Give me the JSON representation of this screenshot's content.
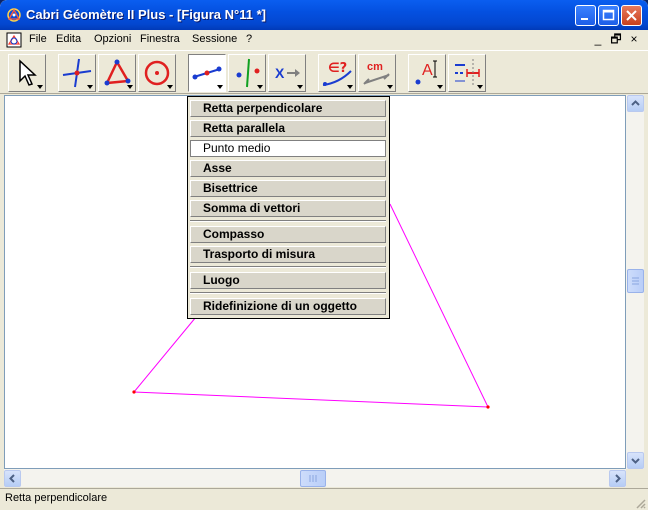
{
  "window": {
    "title": "Cabri Géomètre II Plus - [Figura N°11 *]",
    "buttons": [
      "minimize",
      "maximize",
      "close"
    ]
  },
  "menubar": {
    "items": [
      {
        "label": "File"
      },
      {
        "label": "Edita"
      },
      {
        "label": "Opzioni"
      },
      {
        "label": "Finestra"
      },
      {
        "label": "Sessione"
      },
      {
        "label": "?"
      }
    ],
    "doc_controls": [
      "_",
      "🗗",
      "×"
    ]
  },
  "toolbar": {
    "tools": [
      {
        "name": "pointer",
        "icon": "pointer-arrow-icon"
      },
      {
        "name": "points",
        "icon": "point-on-lines-icon"
      },
      {
        "name": "lines",
        "icon": "triangle-icon"
      },
      {
        "name": "curves",
        "icon": "circle-icon"
      },
      {
        "name": "constructions",
        "icon": "segment-points-icon",
        "active": true
      },
      {
        "name": "transformations",
        "icon": "symmetry-icon"
      },
      {
        "name": "macro",
        "icon": "macro-arrow-icon"
      },
      {
        "name": "properties",
        "icon": "member-check-icon"
      },
      {
        "name": "measure",
        "icon": "measure-cm-icon"
      },
      {
        "name": "display",
        "icon": "label-text-icon"
      },
      {
        "name": "drawing",
        "icon": "drawing-attributes-icon"
      }
    ],
    "text_glyphs": {
      "macro_x": "X",
      "member": "∈?",
      "cm": "cm",
      "label": "A"
    }
  },
  "dropdown": {
    "items": [
      {
        "label": "Retta perpendicolare"
      },
      {
        "label": "Retta parallela"
      },
      {
        "label": "Punto medio",
        "selected": true
      },
      {
        "label": "Asse"
      },
      {
        "label": "Bisettrice"
      },
      {
        "label": "Somma di vettori"
      },
      {
        "label": "Compasso"
      },
      {
        "label": "Trasporto di misura"
      },
      {
        "label": "Luogo"
      },
      {
        "label": "Ridefinizione di un oggetto"
      }
    ]
  },
  "figure": {
    "line_color": "#ff00ff",
    "point_color": "#ff0000"
  },
  "status": {
    "text": "Retta perpendicolare"
  },
  "colors": {
    "titlebar": "#0450e0",
    "chrome": "#ece9d8",
    "canvas": "#ffffff"
  }
}
